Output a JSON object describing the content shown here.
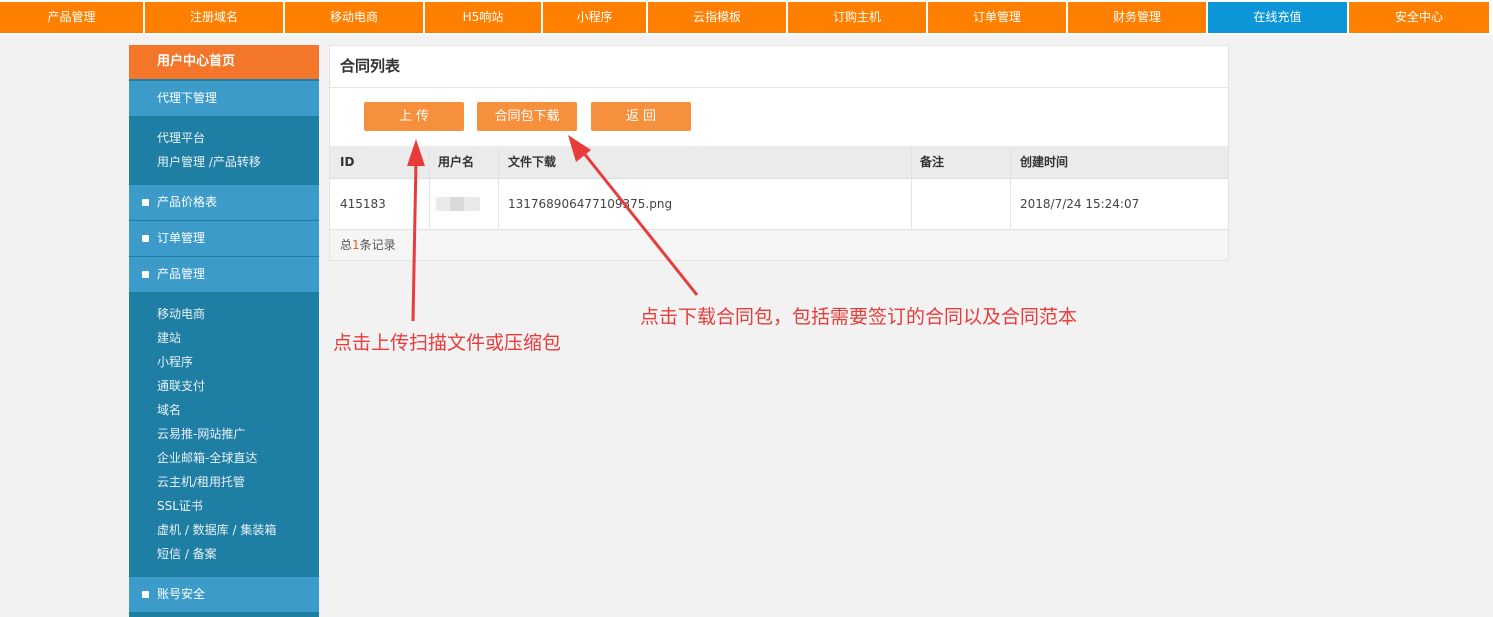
{
  "topnav": [
    {
      "label": "产品管理",
      "active": false
    },
    {
      "label": "注册域名",
      "active": false
    },
    {
      "label": "移动电商",
      "active": false
    },
    {
      "label": "H5响站",
      "active": false
    },
    {
      "label": "小程序",
      "active": false
    },
    {
      "label": "云指模板",
      "active": false
    },
    {
      "label": "订购主机",
      "active": false
    },
    {
      "label": "订单管理",
      "active": false
    },
    {
      "label": "财务管理",
      "active": false
    },
    {
      "label": "在线充值",
      "active": true
    },
    {
      "label": "安全中心",
      "active": false
    }
  ],
  "sidebar": {
    "home": "用户中心首页",
    "agent_head": "代理下管理",
    "agent_links": [
      "代理平台",
      "用户管理 /产品转移"
    ],
    "price_head": "产品价格表",
    "order_head": "订单管理",
    "product_head": "产品管理",
    "product_links": [
      "移动电商",
      "建站",
      "小程序",
      "通联支付",
      "域名",
      "云易推-网站推广",
      "企业邮箱-全球直达",
      "云主机/租用托管",
      "SSL证书",
      "虚机 / 数据库 / 集装箱",
      "短信 / 备案"
    ],
    "account_head": "账号安全"
  },
  "panel": {
    "title": "合同列表",
    "buttons": {
      "upload": "上 传",
      "download": "合同包下载",
      "back": "返 回"
    },
    "columns": [
      "ID",
      "用户名",
      "文件下载",
      "备注",
      "创建时间"
    ],
    "rows": [
      {
        "id": "415183",
        "username": "",
        "file": "13176890647710937​5.png",
        "remark": "",
        "created": "2018/7/24 15:24:07"
      }
    ],
    "footer": {
      "prefix": "总",
      "count": "1",
      "suffix": "条记录"
    }
  },
  "annotations": {
    "upload_hint": "点击上传扫描文件或压缩包",
    "download_hint": "点击下载合同包，包括需要签订的合同以及合同范本"
  },
  "colors": {
    "nav": "#ff7f00",
    "nav_active": "#0c96d8",
    "sidebar": "#1f7ea3",
    "sidebar_head": "#3c9bc9",
    "button": "#f7903c",
    "annotation": "#e83c3c"
  }
}
